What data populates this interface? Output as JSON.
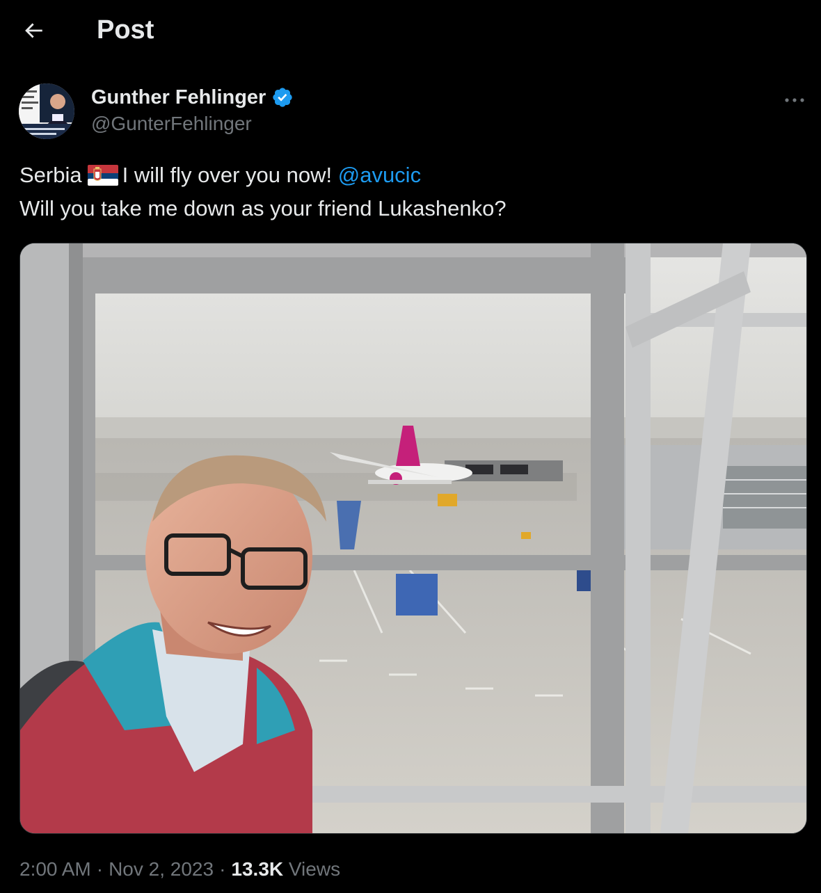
{
  "header": {
    "title": "Post",
    "back_icon": "arrow-left-icon"
  },
  "author": {
    "display_name": "Gunther Fehlinger",
    "handle": "@GunterFehlinger",
    "verified": true,
    "verified_color": "#1d9bf0"
  },
  "tweet": {
    "line1_prefix": "Serbia",
    "flag_icon": "serbia-flag-icon",
    "line1_suffix": "I will fly over you now!",
    "mention": "@avucic",
    "line2": "Will you take me down as your friend Lukashenko?"
  },
  "media": {
    "icon": "selfie-photo"
  },
  "meta": {
    "time": "2:00 AM",
    "separator": "·",
    "date": "Nov 2, 2023",
    "views_count": "13.3K",
    "views_label": "Views"
  },
  "colors": {
    "background": "#000000",
    "text_primary": "#e7e9ea",
    "text_secondary": "#71767b",
    "link": "#1d9bf0"
  }
}
